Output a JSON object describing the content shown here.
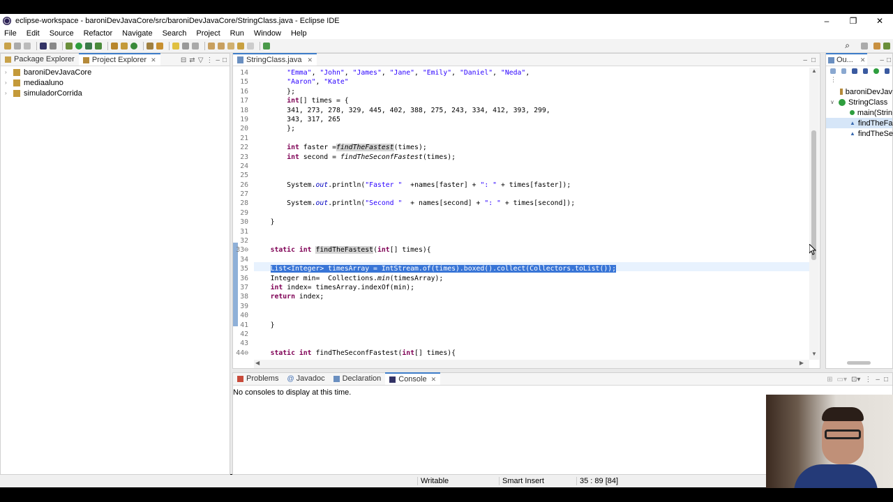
{
  "window": {
    "title": "eclipse-workspace - baroniDevJavaCore/src/baroniDevJavaCore/StringClass.java - Eclipse IDE",
    "minimize": "–",
    "restore": "❐",
    "close": "✕"
  },
  "menu": [
    "File",
    "Edit",
    "Source",
    "Refactor",
    "Navigate",
    "Search",
    "Project",
    "Run",
    "Window",
    "Help"
  ],
  "left_panel": {
    "tabs": [
      {
        "label": "Package Explorer",
        "active": false
      },
      {
        "label": "Project Explorer",
        "active": true
      }
    ],
    "close_icon": "✕",
    "projects": [
      "baroniDevJavaCore",
      "mediaaluno",
      "simuladorCorrida"
    ]
  },
  "editor": {
    "tab_label": "StringClass.java",
    "close_icon": "✕",
    "lines": [
      {
        "n": "14",
        "segs": [
          [
            "",
            "        "
          ],
          [
            "str",
            "\"Emma\""
          ],
          [
            "",
            ", "
          ],
          [
            "str",
            "\"John\""
          ],
          [
            "",
            ", "
          ],
          [
            "str",
            "\"James\""
          ],
          [
            "",
            ", "
          ],
          [
            "str",
            "\"Jane\""
          ],
          [
            "",
            ", "
          ],
          [
            "str",
            "\"Emily\""
          ],
          [
            "",
            ", "
          ],
          [
            "str",
            "\"Daniel\""
          ],
          [
            "",
            ", "
          ],
          [
            "str",
            "\"Neda\""
          ],
          [
            "",
            ","
          ]
        ]
      },
      {
        "n": "15",
        "segs": [
          [
            "",
            "        "
          ],
          [
            "str",
            "\"Aaron\""
          ],
          [
            "",
            ", "
          ],
          [
            "str",
            "\"Kate\""
          ]
        ]
      },
      {
        "n": "16",
        "segs": [
          [
            "",
            "        };"
          ]
        ]
      },
      {
        "n": "17",
        "segs": [
          [
            "",
            "        "
          ],
          [
            "kw",
            "int"
          ],
          [
            "",
            "[] times = {"
          ]
        ]
      },
      {
        "n": "18",
        "segs": [
          [
            "",
            "        341, 273, 278, 329, 445, 402, 388, 275, 243, 334, 412, 393, 299,"
          ]
        ]
      },
      {
        "n": "19",
        "segs": [
          [
            "",
            "        343, 317, 265"
          ]
        ]
      },
      {
        "n": "20",
        "segs": [
          [
            "",
            "        };"
          ]
        ]
      },
      {
        "n": "21",
        "segs": [
          [
            "",
            ""
          ]
        ]
      },
      {
        "n": "22",
        "segs": [
          [
            "",
            "        "
          ],
          [
            "kw",
            "int"
          ],
          [
            "",
            " faster ="
          ],
          [
            "ital occ",
            "findTheFastest"
          ],
          [
            "",
            "(times);"
          ]
        ]
      },
      {
        "n": "23",
        "segs": [
          [
            "",
            "        "
          ],
          [
            "kw",
            "int"
          ],
          [
            "",
            " second = "
          ],
          [
            "ital",
            "findTheSeconfFastest"
          ],
          [
            "",
            "(times);"
          ]
        ]
      },
      {
        "n": "24",
        "segs": [
          [
            "",
            ""
          ]
        ]
      },
      {
        "n": "25",
        "segs": [
          [
            "",
            ""
          ]
        ]
      },
      {
        "n": "26",
        "segs": [
          [
            "",
            "        System."
          ],
          [
            "fld ital",
            "out"
          ],
          [
            "",
            ".println("
          ],
          [
            "str",
            "\"Faster \""
          ],
          [
            "",
            "  +names[faster] + "
          ],
          [
            "str",
            "\": \""
          ],
          [
            "",
            " + times[faster]);"
          ]
        ]
      },
      {
        "n": "27",
        "segs": [
          [
            "",
            ""
          ]
        ]
      },
      {
        "n": "28",
        "segs": [
          [
            "",
            "        System."
          ],
          [
            "fld ital",
            "out"
          ],
          [
            "",
            ".println("
          ],
          [
            "str",
            "\"Second \""
          ],
          [
            "",
            "  + names[second] + "
          ],
          [
            "str",
            "\": \""
          ],
          [
            "",
            " + times[second]);"
          ]
        ]
      },
      {
        "n": "29",
        "segs": [
          [
            "",
            ""
          ]
        ]
      },
      {
        "n": "30",
        "segs": [
          [
            "",
            "    }"
          ]
        ]
      },
      {
        "n": "31",
        "segs": [
          [
            "",
            ""
          ]
        ]
      },
      {
        "n": "32",
        "segs": [
          [
            "",
            ""
          ]
        ]
      },
      {
        "n": "33⊖",
        "segs": [
          [
            "",
            "    "
          ],
          [
            "kw",
            "static int"
          ],
          [
            "",
            " "
          ],
          [
            "occ",
            "findTheFastest"
          ],
          [
            "",
            "("
          ],
          [
            "kw",
            "int"
          ],
          [
            "",
            "[] times){"
          ]
        ]
      },
      {
        "n": "34",
        "segs": [
          [
            "",
            ""
          ]
        ]
      },
      {
        "n": "35",
        "segs": [
          [
            "",
            "    "
          ],
          [
            "hl-sel",
            "List<Integer> timesArray = IntStream.of(times).boxed().collect(Collectors.toList());"
          ]
        ]
      },
      {
        "n": "36",
        "segs": [
          [
            "",
            "    Integer min=  Collections."
          ],
          [
            "ital",
            "min"
          ],
          [
            "",
            "(timesArray);"
          ]
        ]
      },
      {
        "n": "37",
        "segs": [
          [
            "",
            "    "
          ],
          [
            "kw",
            "int"
          ],
          [
            "",
            " index= timesArray.indexOf(min);"
          ]
        ]
      },
      {
        "n": "38",
        "segs": [
          [
            "",
            "    "
          ],
          [
            "kw",
            "return"
          ],
          [
            "",
            " index;"
          ]
        ]
      },
      {
        "n": "39",
        "segs": [
          [
            "",
            ""
          ]
        ]
      },
      {
        "n": "40",
        "segs": [
          [
            "",
            ""
          ]
        ]
      },
      {
        "n": "41",
        "segs": [
          [
            "",
            "    }"
          ]
        ]
      },
      {
        "n": "42",
        "segs": [
          [
            "",
            ""
          ]
        ]
      },
      {
        "n": "43",
        "segs": [
          [
            "",
            ""
          ]
        ]
      },
      {
        "n": "44⊖",
        "segs": [
          [
            "",
            "    "
          ],
          [
            "kw",
            "static int"
          ],
          [
            "",
            " findTheSeconfFastest("
          ],
          [
            "kw",
            "int"
          ],
          [
            "",
            "[] times){"
          ]
        ]
      }
    ]
  },
  "outline": {
    "tab_label": "Ou...",
    "close_icon": "✕",
    "items": [
      "baroniDevJav",
      "StringClass",
      "main(Strin",
      "findTheFas",
      "findTheSec"
    ]
  },
  "bottom_panel": {
    "tabs": [
      {
        "label": "Problems",
        "active": false
      },
      {
        "label": "Javadoc",
        "active": false
      },
      {
        "label": "Declaration",
        "active": false
      },
      {
        "label": "Console",
        "active": true
      }
    ],
    "close_icon": "✕",
    "message": "No consoles to display at this time."
  },
  "status": {
    "writable": "Writable",
    "insert_mode": "Smart Insert",
    "position": "35 : 89 [84]"
  },
  "colors": {
    "keyword": "#7f0055",
    "string": "#2a00ff",
    "field": "#0000c0",
    "selection": "#3875d7",
    "active_tab": "#3d7cc9"
  }
}
